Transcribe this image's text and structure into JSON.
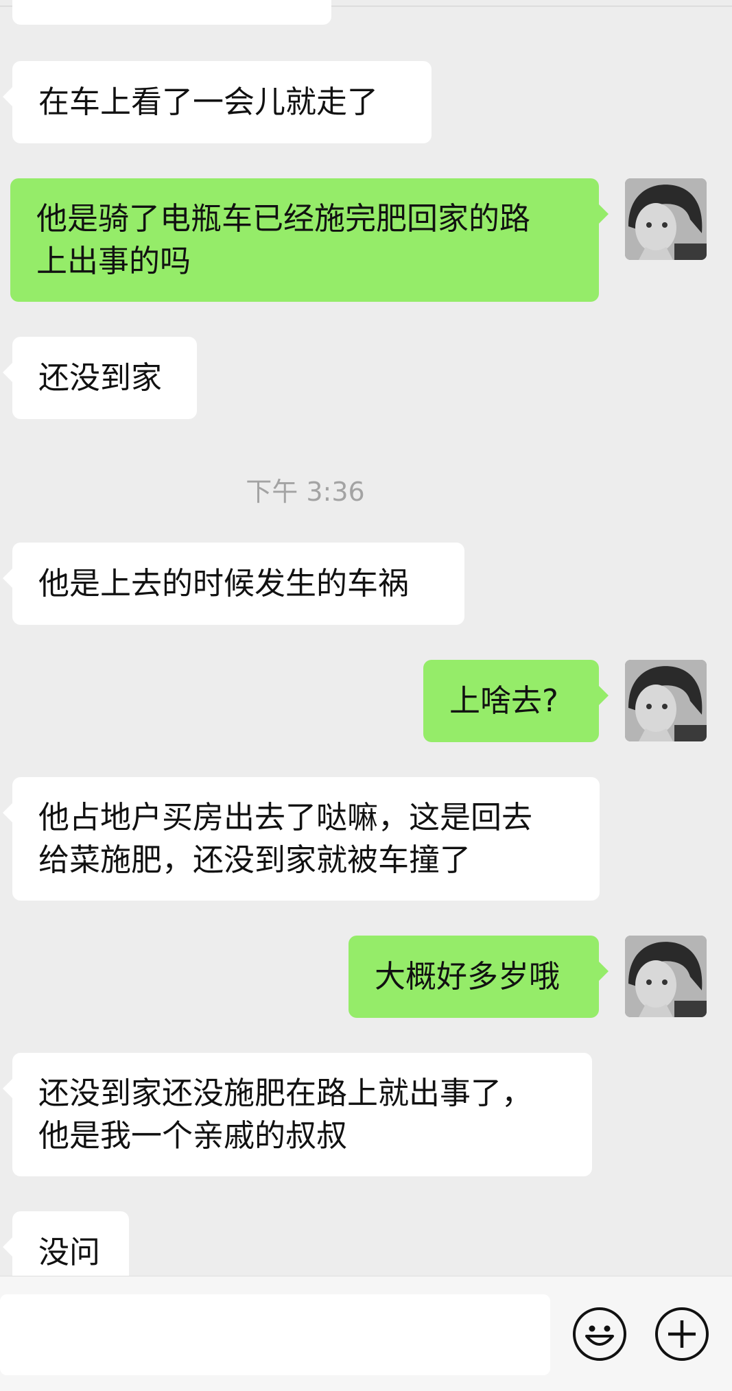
{
  "timestamp": "下午 3:36",
  "messages": [
    {
      "side": "in",
      "text": "在车上看了一会儿就走了"
    },
    {
      "side": "out",
      "text": "他是骑了电瓶车已经施完肥回家的路\n上出事的吗"
    },
    {
      "side": "in",
      "text": "还没到家"
    },
    {
      "side": "in",
      "text": "他是上去的时候发生的车祸"
    },
    {
      "side": "out",
      "text": "上啥去?"
    },
    {
      "side": "in",
      "text": "他占地户买房出去了哒嘛，这是回去\n给菜施肥，还没到家就被车撞了"
    },
    {
      "side": "out",
      "text": "大概好多岁哦"
    },
    {
      "side": "in",
      "text": "还没到家还没施肥在路上就出事了，\n他是我一个亲戚的叔叔"
    },
    {
      "side": "in",
      "text": "没问"
    }
  ],
  "input": {
    "placeholder": ""
  },
  "icons": {
    "emoji": "smiley-face-icon",
    "more": "plus-icon",
    "avatar": "avatar"
  },
  "colors": {
    "incoming": "#ffffff",
    "outgoing": "#95ec69",
    "background": "#ededed"
  }
}
